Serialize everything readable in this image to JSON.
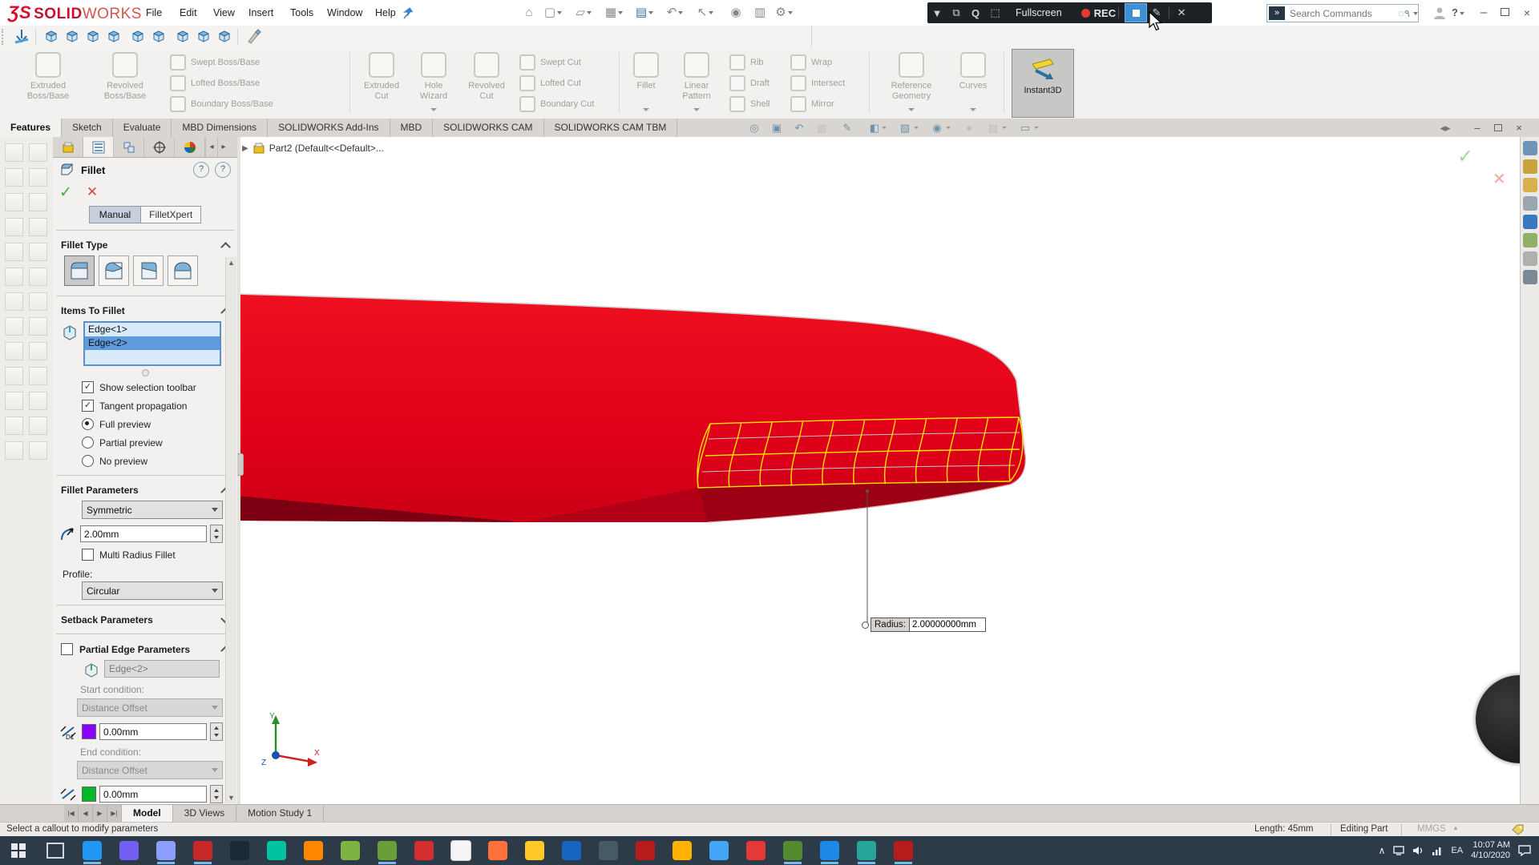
{
  "window": {
    "brand_prefix": "ƷS",
    "brand_solid": "SOLID",
    "brand_works": "WORKS"
  },
  "menubar": {
    "items": [
      "File",
      "Edit",
      "View",
      "Insert",
      "Tools",
      "Window",
      "Help"
    ]
  },
  "recorder": {
    "fullscreen": "Fullscreen",
    "rec": "REC"
  },
  "search": {
    "placeholder": "Search Commands"
  },
  "ribbon": {
    "g1": {
      "big0": "Extruded Boss/Base",
      "big1": "Revolved Boss/Base",
      "s0": "Swept Boss/Base",
      "s1": "Lofted Boss/Base",
      "s2": "Boundary Boss/Base"
    },
    "g2": {
      "big0": "Extruded Cut",
      "big1": "Hole Wizard",
      "big2": "Revolved Cut",
      "s0": "Swept Cut",
      "s1": "Lofted Cut",
      "s2": "Boundary Cut"
    },
    "g3": {
      "big0": "Fillet",
      "big1": "Linear Pattern",
      "s0": "Rib",
      "s1": "Draft",
      "s2": "Shell",
      "t0": "Wrap",
      "t1": "Intersect",
      "t2": "Mirror"
    },
    "g4": {
      "big0": "Reference Geometry",
      "big1": "Curves"
    },
    "g5": {
      "big0": "Instant3D"
    }
  },
  "tabs": {
    "t0": "Features",
    "t1": "Sketch",
    "t2": "Evaluate",
    "t3": "MBD Dimensions",
    "t4": "SOLIDWORKS Add-Ins",
    "t5": "MBD",
    "t6": "SOLIDWORKS CAM",
    "t7": "SOLIDWORKS CAM TBM"
  },
  "panel": {
    "title": "Fillet",
    "mode_manual": "Manual",
    "mode_xpert": "FilletXpert",
    "fillet_type_label": "Fillet Type",
    "items_label": "Items To Fillet",
    "edge1": "Edge<1>",
    "edge2": "Edge<2>",
    "cb_show": "Show selection toolbar",
    "cb_tangent": "Tangent propagation",
    "r_full": "Full preview",
    "r_partial": "Partial preview",
    "r_none": "No preview",
    "params_label": "Fillet Parameters",
    "symmetry": "Symmetric",
    "radius": "2.00mm",
    "cb_multi": "Multi Radius Fillet",
    "profile_label": "Profile:",
    "profile": "Circular",
    "setback_label": "Setback Parameters",
    "partial_label": "Partial Edge Parameters",
    "partial_edge": "Edge<2>",
    "start_label": "Start condition:",
    "start_value": "Distance Offset",
    "start_offset": "0.00mm",
    "end_label": "End condition:",
    "end_value": "Distance Offset",
    "end_offset": "0.00mm"
  },
  "viewport": {
    "breadcrumb": "Part2  (Default<<Default>...",
    "callout_label": "Radius:",
    "callout_value": "2.00000000mm"
  },
  "doc_tabs": {
    "t0": "Model",
    "t1": "3D Views",
    "t2": "Motion Study 1"
  },
  "statusbar": {
    "message": "Select a callout to modify parameters",
    "length": "Length: 45mm",
    "mode": "Editing Part",
    "units": "MMGS"
  },
  "taskbar": {
    "tray": {
      "language": "EA",
      "time": "10:07 AM",
      "date": "4/10/2020"
    },
    "apps": [
      {
        "name": "start",
        "color": "",
        "running": false
      },
      {
        "name": "task-view",
        "color": "",
        "running": false
      },
      {
        "name": "tracen",
        "color": "#2196f3",
        "running": true
      },
      {
        "name": "viber",
        "color": "#7360f2",
        "running": false
      },
      {
        "name": "discord",
        "color": "#8c9eff",
        "running": true
      },
      {
        "name": "lightning-app",
        "color": "#c62828",
        "running": true
      },
      {
        "name": "steam",
        "color": "#1b2838",
        "running": false
      },
      {
        "name": "filmora",
        "color": "#00c3a0",
        "running": false
      },
      {
        "name": "vlc",
        "color": "#ff8800",
        "running": false
      },
      {
        "name": "leaf-app",
        "color": "#7cb342",
        "running": false
      },
      {
        "name": "calendar-app",
        "color": "#689f38",
        "running": true
      },
      {
        "name": "screen-recorder",
        "color": "#d32f2f",
        "running": false
      },
      {
        "name": "oculus",
        "color": "#f5f5f5",
        "running": false
      },
      {
        "name": "firefox",
        "color": "#ff7139",
        "running": false
      },
      {
        "name": "file-explorer",
        "color": "#ffca28",
        "running": false
      },
      {
        "name": "remote-desktop",
        "color": "#1565c0",
        "running": false
      },
      {
        "name": "cinema4d",
        "color": "#455a64",
        "running": false
      },
      {
        "name": "solidworks-2019",
        "color": "#b71c1c",
        "running": false
      },
      {
        "name": "sketchup",
        "color": "#ffb300",
        "running": false
      },
      {
        "name": "media-player",
        "color": "#42a5f5",
        "running": false
      },
      {
        "name": "red-diamond-app",
        "color": "#e53935",
        "running": false
      },
      {
        "name": "coreldraw",
        "color": "#558b2f",
        "running": true
      },
      {
        "name": "steam-2",
        "color": "#1e88e5",
        "running": true
      },
      {
        "name": "maya",
        "color": "#26a69a",
        "running": true
      },
      {
        "name": "solidworks-2019-b",
        "color": "#b71c1c",
        "running": true
      }
    ]
  },
  "taskpane": {
    "icons": [
      "resources",
      "design-library",
      "file-explorer",
      "view-palette",
      "appearances",
      "custom-properties",
      "forum",
      "sensors"
    ],
    "icon_colors": [
      "#6f94b8",
      "#c9a43c",
      "#d8b14e",
      "#9aa7b2",
      "#3a77c2",
      "#8fb069",
      "#b0b0ae",
      "#7d8a96"
    ]
  },
  "colors": {
    "part_red": "#e30019",
    "part_dark": "#7c0011",
    "fillet_preview": "#ffe600",
    "selection_blue": "#5f9bdc",
    "recorder_bg": "#1d2227",
    "taskbar_bg": "#2d3b48"
  }
}
